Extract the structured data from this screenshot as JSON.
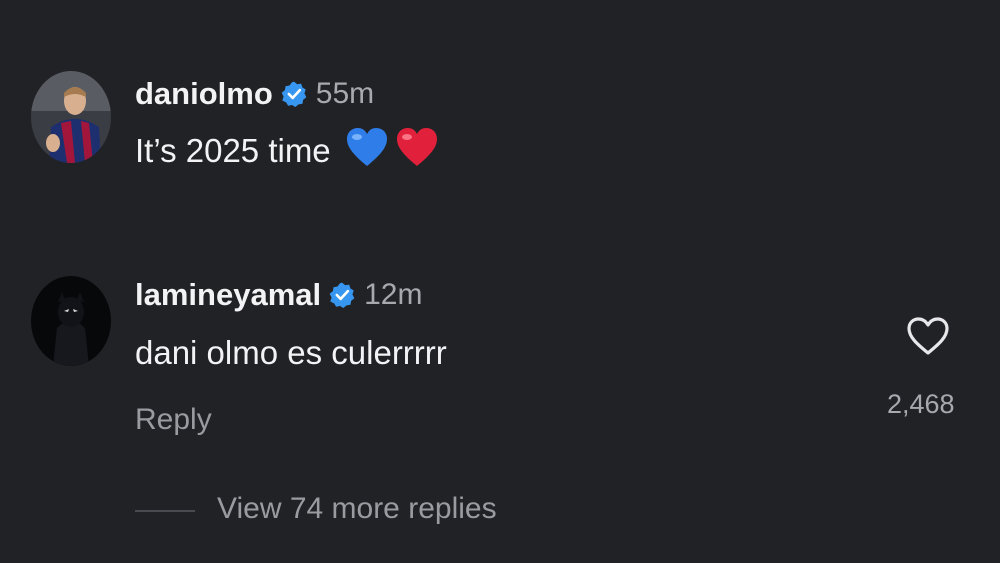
{
  "comments": [
    {
      "username": "daniolmo",
      "verified_icon": "verified-badge-icon",
      "time": "55m",
      "text": "It’s 2025 time",
      "emojis": [
        "blue-heart",
        "red-heart"
      ]
    },
    {
      "username": "lamineyamal",
      "verified_icon": "verified-badge-icon",
      "time": "12m",
      "text": "dani olmo es culerrrrr",
      "reply_label": "Reply",
      "like_icon": "heart-outline-icon",
      "like_count": "2,468"
    }
  ],
  "view_replies_label": "View 74 more replies",
  "colors": {
    "background": "#212226",
    "verified_blue": "#3797f0",
    "secondary_text": "#9a9ba0"
  }
}
